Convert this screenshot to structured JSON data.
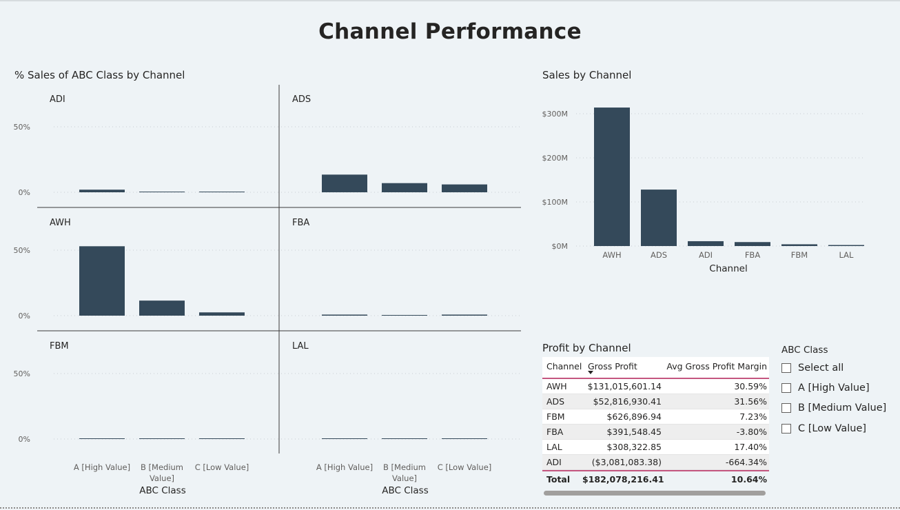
{
  "page_title": "Channel Performance",
  "colors": {
    "bar": "#34495a",
    "accent_line": "#c4567f",
    "background": "#eef3f6"
  },
  "abc_chart": {
    "title": "% Sales of ABC Class by Channel",
    "xlabel": "ABC Class",
    "categories": [
      "A [High Value]",
      "B [Medium Value]",
      "C [Low Value]"
    ],
    "category_lines": [
      [
        "A [High Value]"
      ],
      [
        "B [Medium",
        "Value]"
      ],
      [
        "C [Low Value]"
      ]
    ],
    "y_ticks": [
      "50%",
      "0%"
    ]
  },
  "sales_chart": {
    "title": "Sales by Channel",
    "xlabel": "Channel",
    "y_ticks": [
      "$300M",
      "$200M",
      "$100M",
      "$0M"
    ]
  },
  "chart_data": [
    {
      "type": "bar",
      "title": "% Sales of ABC Class by Channel",
      "xlabel": "ABC Class",
      "ylabel": "",
      "categories": [
        "A [High Value]",
        "B [Medium Value]",
        "C [Low Value]"
      ],
      "ylim": [
        0,
        0.5
      ],
      "y_tick_values": [
        0,
        0.5
      ],
      "grid": true,
      "facets": [
        {
          "name": "ADI",
          "values": [
            0.02,
            0.005,
            0.005
          ]
        },
        {
          "name": "ADS",
          "values": [
            0.135,
            0.07,
            0.06
          ]
        },
        {
          "name": "AWH",
          "values": [
            0.53,
            0.115,
            0.025
          ]
        },
        {
          "name": "FBA",
          "values": [
            0.008,
            0.004,
            0.008
          ]
        },
        {
          "name": "FBM",
          "values": [
            0.003,
            0.003,
            0.003
          ]
        },
        {
          "name": "LAL",
          "values": [
            0.003,
            0.003,
            0.003
          ]
        }
      ]
    },
    {
      "type": "bar",
      "title": "Sales by Channel",
      "xlabel": "Channel",
      "ylabel": "",
      "categories": [
        "AWH",
        "ADS",
        "ADI",
        "FBA",
        "FBM",
        "LAL"
      ],
      "values": [
        314,
        128,
        11,
        9,
        4,
        1
      ],
      "unit": "$M",
      "ylim": [
        0,
        300
      ],
      "y_tick_values": [
        300,
        200,
        100,
        0
      ],
      "grid": true
    },
    {
      "type": "table",
      "title": "Profit by Channel",
      "columns": [
        "Channel",
        "Gross Profit",
        "Avg Gross Profit Margin"
      ],
      "rows": [
        [
          "AWH",
          "$131,015,601.14",
          "30.59%"
        ],
        [
          "ADS",
          "$52,816,930.41",
          "31.56%"
        ],
        [
          "FBM",
          "$626,896.94",
          "7.23%"
        ],
        [
          "FBA",
          "$391,548.45",
          "-3.80%"
        ],
        [
          "LAL",
          "$308,322.85",
          "17.40%"
        ],
        [
          "ADI",
          "($3,081,083.38)",
          "-664.34%"
        ]
      ],
      "total": [
        "Total",
        "$182,078,216.41",
        "10.64%"
      ]
    }
  ],
  "profit_table": {
    "title": "Profit by Channel",
    "headers": [
      "Channel",
      "Gross Profit",
      "Avg Gross Profit Margin"
    ],
    "rows": [
      [
        "AWH",
        "$131,015,601.14",
        "30.59%"
      ],
      [
        "ADS",
        "$52,816,930.41",
        "31.56%"
      ],
      [
        "FBM",
        "$626,896.94",
        "7.23%"
      ],
      [
        "FBA",
        "$391,548.45",
        "-3.80%"
      ],
      [
        "LAL",
        "$308,322.85",
        "17.40%"
      ],
      [
        "ADI",
        "($3,081,083.38)",
        "-664.34%"
      ]
    ],
    "total": [
      "Total",
      "$182,078,216.41",
      "10.64%"
    ]
  },
  "slicer": {
    "title": "ABC Class",
    "items": [
      "Select all",
      "A [High Value]",
      "B [Medium Value]",
      "C [Low Value]"
    ]
  }
}
